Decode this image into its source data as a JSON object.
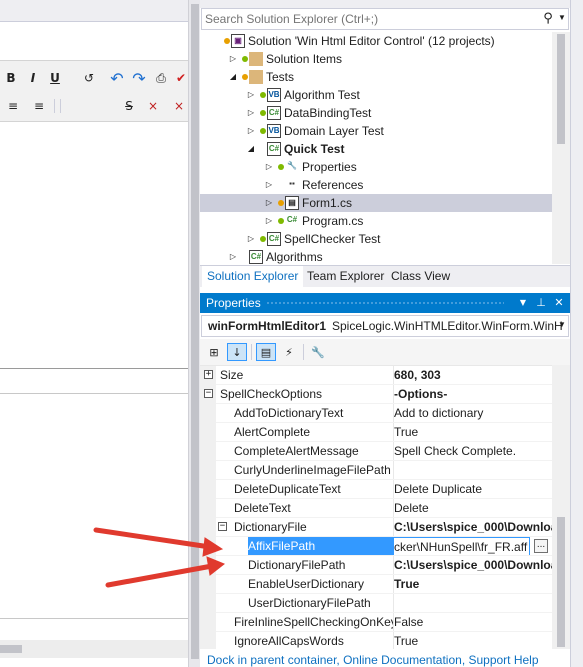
{
  "solution_explorer": {
    "search_placeholder": "Search Solution Explorer (Ctrl+;)",
    "tree": [
      {
        "label": "Solution 'Win Html Editor Control' (12 projects)",
        "bold": false,
        "icon": "solution-icon",
        "indent": 0,
        "expander": "none",
        "dot": "#e8a000"
      },
      {
        "label": "Solution Items",
        "bold": false,
        "icon": "folder-icon",
        "indent": 1,
        "expander": "collapsed",
        "dot": "#7fba00"
      },
      {
        "label": "Tests",
        "bold": false,
        "icon": "folder-icon",
        "indent": 1,
        "expander": "expanded",
        "dot": "#e8a000"
      },
      {
        "label": "Algorithm Test",
        "bold": false,
        "icon": "vb-project-icon",
        "indent": 2,
        "expander": "collapsed",
        "dot": "#7fba00"
      },
      {
        "label": "DataBindingTest",
        "bold": false,
        "icon": "csharp-project-icon",
        "indent": 2,
        "expander": "collapsed",
        "dot": "#7fba00"
      },
      {
        "label": "Domain Layer Test",
        "bold": false,
        "icon": "vb-project-icon",
        "indent": 2,
        "expander": "collapsed",
        "dot": "#7fba00"
      },
      {
        "label": "Quick Test",
        "bold": true,
        "icon": "csharp-project-icon",
        "indent": 2,
        "expander": "expanded",
        "dot": "none"
      },
      {
        "label": "Properties",
        "bold": false,
        "icon": "wrench-icon",
        "indent": 3,
        "expander": "collapsed",
        "dot": "#7fba00"
      },
      {
        "label": "References",
        "bold": false,
        "icon": "references-icon",
        "indent": 3,
        "expander": "collapsed",
        "dot": "none"
      },
      {
        "label": "Form1.cs",
        "bold": false,
        "icon": "form-icon",
        "indent": 3,
        "expander": "collapsed",
        "dot": "#e8a000",
        "selected": true
      },
      {
        "label": "Program.cs",
        "bold": false,
        "icon": "csharp-file-icon",
        "indent": 3,
        "expander": "collapsed",
        "dot": "#7fba00"
      },
      {
        "label": "SpellChecker Test",
        "bold": false,
        "icon": "csharp-project-icon",
        "indent": 2,
        "expander": "collapsed",
        "dot": "#7fba00"
      },
      {
        "label": "Algorithms",
        "bold": false,
        "icon": "csharp-project-icon",
        "indent": 1,
        "expander": "collapsed",
        "dot": "none"
      }
    ],
    "tabs": [
      "Solution Explorer",
      "Team Explorer",
      "Class View"
    ]
  },
  "properties": {
    "title": "Properties",
    "object_name": "winFormHtmlEditor1",
    "object_type": "SpiceLogic.WinHTMLEditor.WinForm.WinH",
    "rows": [
      {
        "name": "Size",
        "value": "680, 303",
        "level": 0,
        "expander": "plus",
        "bold": true
      },
      {
        "name": "SpellCheckOptions",
        "value": "-Options-",
        "level": 0,
        "expander": "minus",
        "bold": true
      },
      {
        "name": "AddToDictionaryText",
        "value": "Add to dictionary",
        "level": 1,
        "expander": "none"
      },
      {
        "name": "AlertComplete",
        "value": "True",
        "level": 1,
        "expander": "none"
      },
      {
        "name": "CompleteAlertMessage",
        "value": "Spell Check Complete.",
        "level": 1,
        "expander": "none"
      },
      {
        "name": "CurlyUnderlineImageFilePath",
        "value": "",
        "level": 1,
        "expander": "none"
      },
      {
        "name": "DeleteDuplicateText",
        "value": "Delete Duplicate",
        "level": 1,
        "expander": "none"
      },
      {
        "name": "DeleteText",
        "value": "Delete",
        "level": 1,
        "expander": "none"
      },
      {
        "name": "DictionaryFile",
        "value": "C:\\Users\\spice_000\\Downloa",
        "level": 1,
        "expander": "minus",
        "bold": true
      },
      {
        "name": "AffixFilePath",
        "value": "cker\\NHunSpell\\fr_FR.aff",
        "level": 2,
        "expander": "none",
        "selected": true,
        "editing": true
      },
      {
        "name": "DictionaryFilePath",
        "value": "C:\\Users\\spice_000\\Downloa",
        "level": 2,
        "expander": "none",
        "bold": true
      },
      {
        "name": "EnableUserDictionary",
        "value": "True",
        "level": 2,
        "expander": "none",
        "bold": true
      },
      {
        "name": "UserDictionaryFilePath",
        "value": "",
        "level": 2,
        "expander": "none"
      },
      {
        "name": "FireInlineSpellCheckingOnKey",
        "value": "False",
        "level": 1,
        "expander": "none"
      },
      {
        "name": "IgnoreAllCapsWords",
        "value": "True",
        "level": 1,
        "expander": "none"
      }
    ],
    "links": "Dock in parent container, Online Documentation, Support Help"
  },
  "editor_toolbar": {
    "bold": "B",
    "italic": "I",
    "underline": "U"
  },
  "colors": {
    "accent": "#007acc",
    "selection": "#3399ff",
    "tree_selected": "#cccedb",
    "arrow_red": "#e03a2e"
  }
}
